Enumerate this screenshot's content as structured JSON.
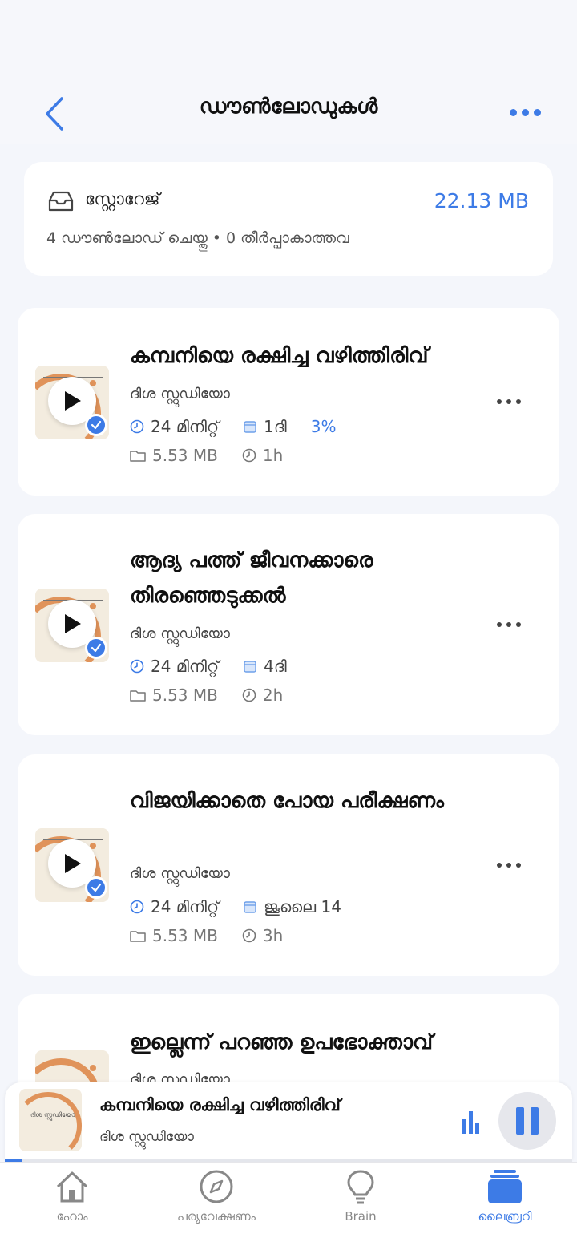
{
  "header": {
    "title": "ഡൗൺലോഡുകൾ",
    "back_icon": "chevron-left-icon",
    "more_icon": "more-horizontal-icon",
    "accent_color": "#3d7be6"
  },
  "storage": {
    "label": "സ്റ്റോറേജ്",
    "size": "22.13 MB",
    "stats": "4 ഡൗൺലോഡ് ചെയ്തു • 0 തീർപ്പാകാത്തവ",
    "icon": "tray-icon"
  },
  "episodes": [
    {
      "title": "കമ്പനിയെ രക്ഷിച്ച വഴിത്തിരിവ്",
      "author": "ദിശ സ്റ്റുഡിയോ",
      "duration": "24 മിനിറ്റ്",
      "date": "1ദി",
      "progress": "3%",
      "size": "5.53 MB",
      "age": "1h"
    },
    {
      "title": "ആദ്യ പത്ത് ജീവനക്കാരെ തിരഞ്ഞെടുക്കൽ",
      "author": "ദിശ സ്റ്റുഡിയോ",
      "duration": "24 മിനിറ്റ്",
      "date": "4ദി",
      "size": "5.53 MB",
      "age": "2h"
    },
    {
      "title": "വിജയിക്കാതെ പോയ പരീക്ഷണം",
      "author": "ദിശ സ്റ്റുഡിയോ",
      "duration": "24 മിനിറ്റ്",
      "date": "ജൂലൈ 14",
      "size": "5.53 MB",
      "age": "3h"
    },
    {
      "title": "ഇല്ലെന്ന് പറഞ്ഞ ഉപഭോക്താവ്",
      "author": "ദിശ സ്റ്റുഡിയോ"
    }
  ],
  "mini_player": {
    "title": "കമ്പനിയെ രക്ഷിച്ച വഴിത്തിരിവ്",
    "author": "ദിശ സ്റ്റുഡിയോ",
    "thumb_text": "ദിശ സ്റ്റുഡിയോ",
    "progress_fraction": 0.03
  },
  "tabs": [
    {
      "label": "ഹോം",
      "icon": "home-icon",
      "active": false
    },
    {
      "label": "പര്യവേക്ഷണം",
      "icon": "compass-icon",
      "active": false
    },
    {
      "label": "Brain",
      "icon": "lightbulb-icon",
      "active": false
    },
    {
      "label": "ലൈബ്രറി",
      "icon": "library-icon",
      "active": true
    }
  ]
}
